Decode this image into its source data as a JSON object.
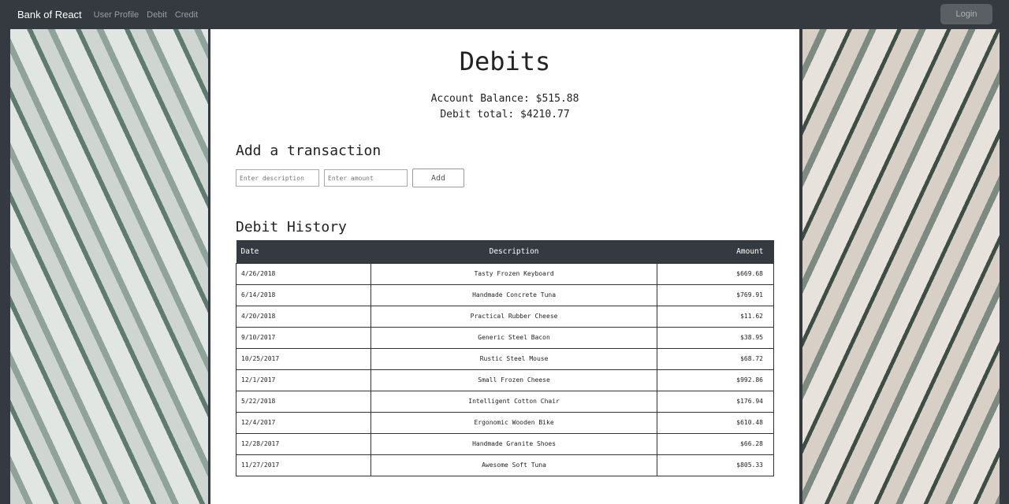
{
  "nav": {
    "brand": "Bank of React",
    "links": [
      "User Profile",
      "Debit",
      "Credit"
    ],
    "login": "Login"
  },
  "page": {
    "title": "Debits",
    "balance": "Account Balance: $515.88",
    "total": "Debit total: $4210.77"
  },
  "form": {
    "heading": "Add a transaction",
    "description_placeholder": "Enter description",
    "amount_placeholder": "Enter amount",
    "add": "Add"
  },
  "history": {
    "heading": "Debit History",
    "columns": [
      "Date",
      "Description",
      "Amount"
    ],
    "rows": [
      [
        "4/26/2018",
        "Tasty Frozen Keyboard",
        "$669.68"
      ],
      [
        "6/14/2018",
        "Handmade Concrete Tuna",
        "$769.91"
      ],
      [
        "4/20/2018",
        "Practical Rubber Cheese",
        "$11.62"
      ],
      [
        "9/10/2017",
        "Generic Steel Bacon",
        "$38.95"
      ],
      [
        "10/25/2017",
        "Rustic Steel Mouse",
        "$68.72"
      ],
      [
        "12/1/2017",
        "Small Frozen Cheese",
        "$992.86"
      ],
      [
        "5/22/2018",
        "Intelligent Cotton Chair",
        "$176.94"
      ],
      [
        "12/4/2017",
        "Ergonomic Wooden Bike",
        "$610.48"
      ],
      [
        "12/28/2017",
        "Handmade Granite Shoes",
        "$66.28"
      ],
      [
        "11/27/2017",
        "Awesome Soft Tuna",
        "$805.33"
      ]
    ]
  }
}
